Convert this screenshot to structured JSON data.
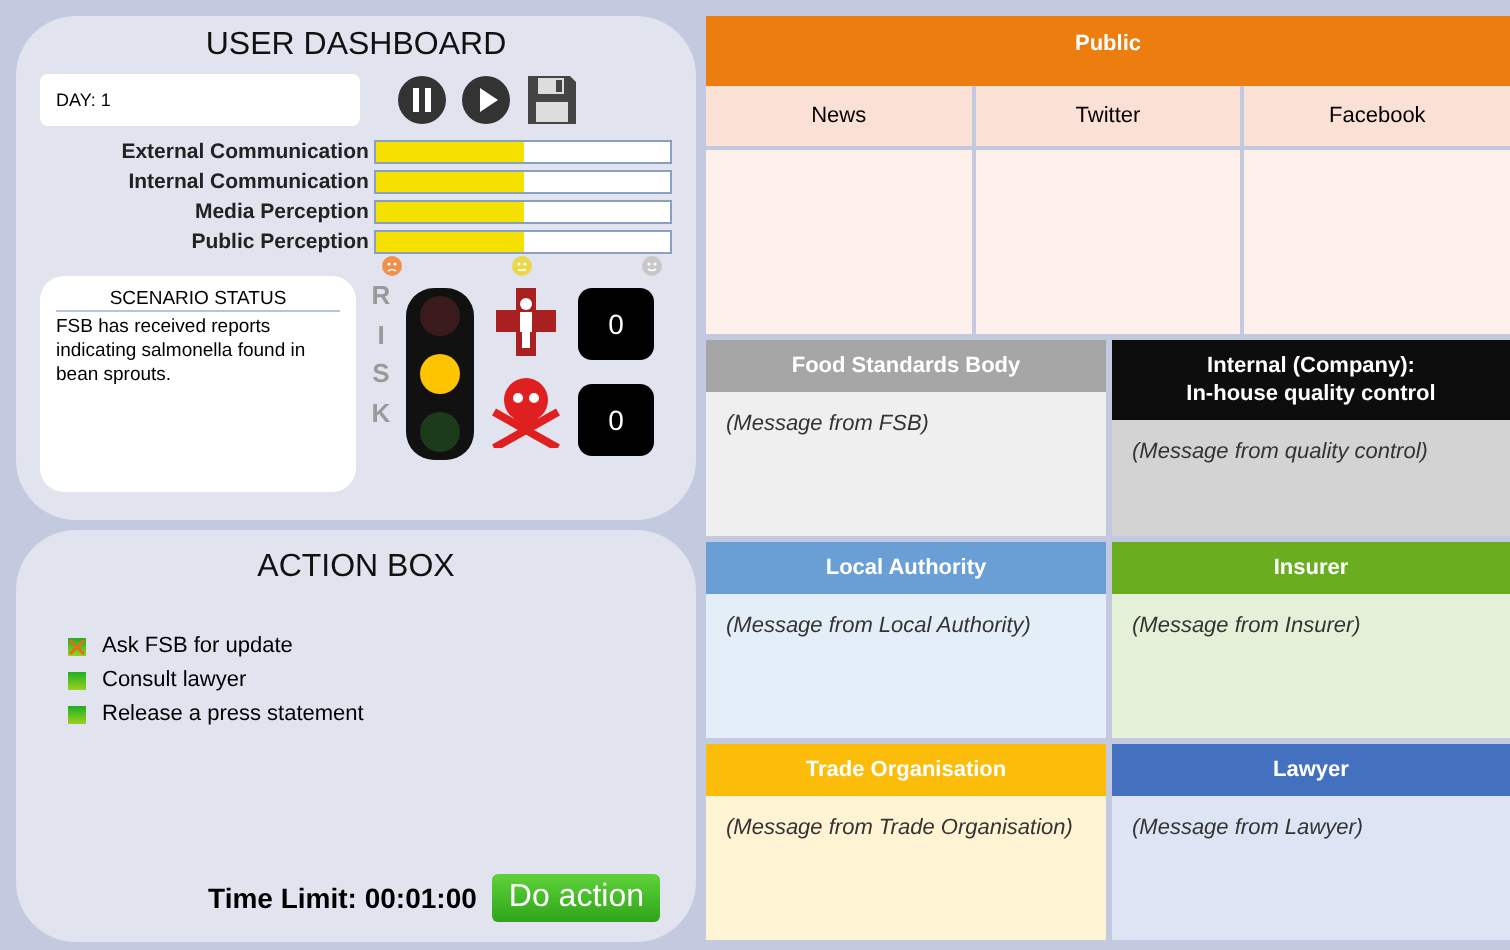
{
  "dashboard": {
    "title": "USER DASHBOARD",
    "day": "DAY: 1",
    "meters": [
      {
        "label": "External Communication",
        "level": 0.5
      },
      {
        "label": "Internal Communication",
        "level": 0.5
      },
      {
        "label": "Media Perception",
        "level": 0.5
      },
      {
        "label": "Public Perception",
        "level": 0.5
      }
    ],
    "scenario": {
      "title": "SCENARIO STATUS",
      "text": "FSB has received reports indicating salmonella found in bean sprouts."
    },
    "risk": {
      "label": "RISK",
      "lights": [
        {
          "on": false
        },
        {
          "on": true
        },
        {
          "on": false
        }
      ]
    },
    "injured_count": "0",
    "death_count": "0"
  },
  "action_box": {
    "title": "ACTION BOX",
    "actions": [
      {
        "label": "Ask FSB for update",
        "checked": true
      },
      {
        "label": "Consult lawyer",
        "checked": false
      },
      {
        "label": "Release a press statement",
        "checked": false
      }
    ],
    "time_limit": "Time Limit: 00:01:00",
    "button": "Do action"
  },
  "public": {
    "title": "Public",
    "columns": [
      "News",
      "Twitter",
      "Facebook"
    ]
  },
  "message_panels": [
    {
      "title": "Food Standards Body",
      "color": "#a6a6a6",
      "message": "(Message from FSB)"
    },
    {
      "title": "Internal (Company):\nIn-house quality control",
      "color": "#0d0d0d",
      "message": "(Message from quality control)"
    },
    {
      "title": "Local Authority",
      "color": "#6a9fd6",
      "message": "(Message from Local Authority)"
    },
    {
      "title": "Insurer",
      "color": "#6aad1e",
      "message": "(Message from Insurer)"
    },
    {
      "title": "Trade Organisation",
      "color": "#fbbd0a",
      "message": "(Message from Trade Organisation)"
    },
    {
      "title": "Lawyer",
      "color": "#4470c0",
      "message": "(Message from Lawyer)"
    }
  ]
}
